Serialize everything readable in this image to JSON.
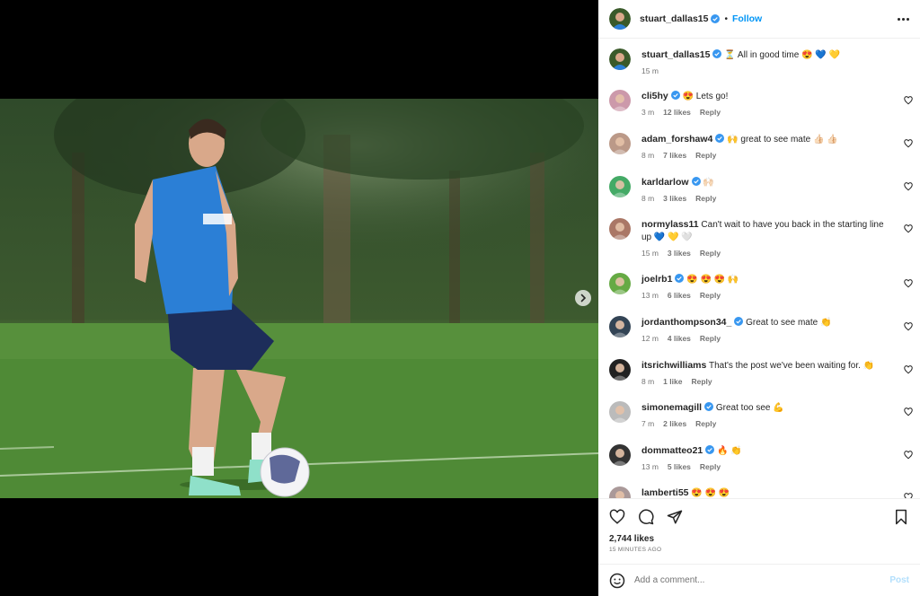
{
  "header": {
    "username": "stuart_dallas15",
    "follow_label": "Follow",
    "separator": "•"
  },
  "caption": {
    "username": "stuart_dallas15",
    "text": "⏳ All in good time 😍 💙 💛",
    "time": "15 m"
  },
  "comments": [
    {
      "username": "cli5hy",
      "verified": true,
      "text": "😍 Lets go!",
      "time": "3 m",
      "likes": "12 likes",
      "reply": "Reply",
      "avatar_color": "#c9a"
    },
    {
      "username": "adam_forshaw4",
      "verified": true,
      "text": "🙌 great to see mate 👍🏻 👍🏻",
      "time": "8 m",
      "likes": "7 likes",
      "reply": "Reply",
      "avatar_color": "#b98"
    },
    {
      "username": "karldarlow",
      "verified": true,
      "text": "🙌🏻",
      "time": "8 m",
      "likes": "3 likes",
      "reply": "Reply",
      "avatar_color": "#4a6"
    },
    {
      "username": "normylass11",
      "verified": false,
      "text": "Can't wait to have you back in the starting line up 💙 💛 🤍",
      "time": "15 m",
      "likes": "3 likes",
      "reply": "Reply",
      "avatar_color": "#a76"
    },
    {
      "username": "joelrb1",
      "verified": true,
      "text": "😍 😍 😍 🙌",
      "time": "13 m",
      "likes": "6 likes",
      "reply": "Reply",
      "avatar_color": "#6a4"
    },
    {
      "username": "jordanthompson34_",
      "verified": true,
      "text": "Great to see mate 👏",
      "time": "12 m",
      "likes": "4 likes",
      "reply": "Reply",
      "avatar_color": "#345"
    },
    {
      "username": "itsrichwilliams",
      "verified": false,
      "text": "That's the post we've been waiting for. 👏",
      "time": "8 m",
      "likes": "1 like",
      "reply": "Reply",
      "avatar_color": "#222"
    },
    {
      "username": "simonemagill",
      "verified": true,
      "text": "Great too see 💪",
      "time": "7 m",
      "likes": "2 likes",
      "reply": "Reply",
      "avatar_color": "#bbb"
    },
    {
      "username": "dommatteo21",
      "verified": true,
      "text": "🔥 👏",
      "time": "13 m",
      "likes": "5 likes",
      "reply": "Reply",
      "avatar_color": "#333"
    },
    {
      "username": "lamberti55",
      "verified": false,
      "text": "😍 😍 😍",
      "time": "",
      "likes": "",
      "reply": "",
      "avatar_color": "#a99"
    }
  ],
  "likes_count": "2,744 likes",
  "posted_time": "15 MINUTES AGO",
  "comment_box": {
    "placeholder": "Add a comment...",
    "post_label": "Post"
  },
  "icons": {
    "more": "more-options-icon",
    "next": "chevron-right-icon",
    "like": "heart-icon",
    "comment": "comment-icon",
    "share": "paper-plane-icon",
    "save": "bookmark-icon",
    "emoji": "smiley-icon",
    "verified": "verified-badge-icon"
  },
  "colors": {
    "accent": "#0095f6",
    "verified": "#3897f0",
    "post_disabled": "#b2dffc",
    "muted": "#737373"
  }
}
